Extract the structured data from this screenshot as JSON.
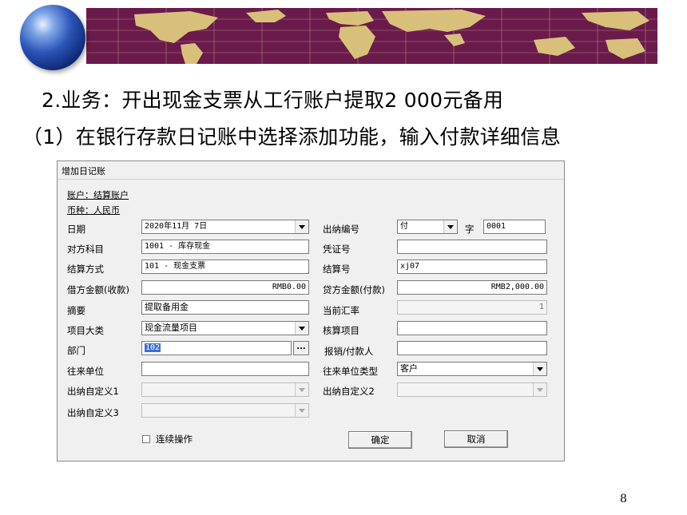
{
  "slide": {
    "heading": "2.业务：开出现金支票从工行账户提取2 000元备用",
    "subheading": "（1）在银行存款日记账中选择添加功能，输入付款详细信息",
    "page_number": "8"
  },
  "dialog": {
    "title": "增加日记账",
    "account": "账户：结算账户",
    "currency": "币种：人民币",
    "labels": {
      "date": "日期",
      "cashier_no": "出纳编号",
      "zi": "字",
      "counter_subject": "对方科目",
      "voucher_no": "凭证号",
      "settle_method": "结算方式",
      "settle_no": "结算号",
      "debit_amount": "借方金额(收款)",
      "credit_amount": "贷方金额(付款)",
      "summary": "摘要",
      "exchange_rate": "当前汇率",
      "project_category": "项目大类",
      "accounting_item": "核算项目",
      "department": "部门",
      "payee": "报销/付款人",
      "contact_unit": "往来单位",
      "contact_type": "往来单位类型",
      "custom1": "出纳自定义1",
      "custom2": "出纳自定义2",
      "custom3": "出纳自定义3",
      "continuous": "连续操作"
    },
    "values": {
      "date": "2020年11月 7日",
      "cashier_type": "付",
      "cashier_no": "0001",
      "counter_subject": "1001 - 库存现金",
      "voucher_no": "",
      "settle_method": "101 - 现金支票",
      "settle_no": "xj07",
      "debit_amount": "RMB0.00",
      "credit_amount": "RMB2,000.00",
      "summary": "提取备用金",
      "exchange_rate": "1",
      "project_category": "现金流量项目",
      "accounting_item": "",
      "department": "102",
      "payee": "",
      "contact_unit": "",
      "contact_type": "客户",
      "custom1": "",
      "custom2": "",
      "custom3": ""
    },
    "buttons": {
      "ok": "确定",
      "cancel": "取消",
      "ellipsis": "..."
    },
    "continuous_checked": false
  },
  "colors": {
    "banner_bg": "#6b1a4c",
    "land": "#d8c07a",
    "dialog_bg": "#f0f0f0"
  }
}
